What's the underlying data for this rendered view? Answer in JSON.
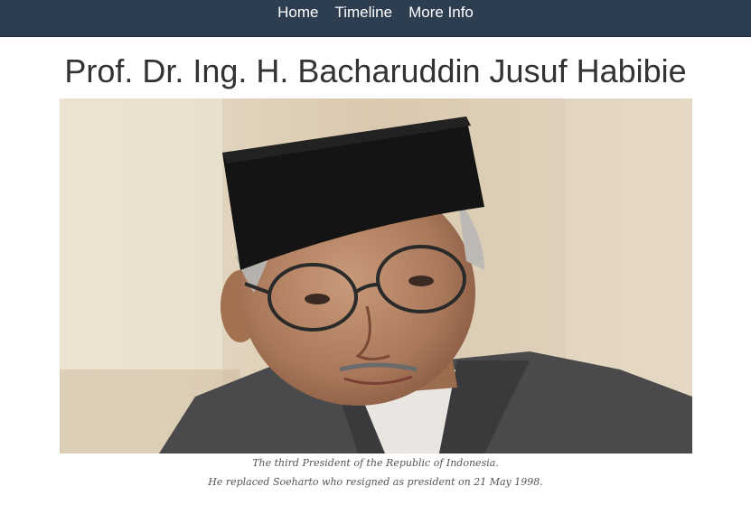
{
  "nav": {
    "items": [
      {
        "label": "Home"
      },
      {
        "label": "Timeline"
      },
      {
        "label": "More Info"
      }
    ]
  },
  "page": {
    "title": "Prof. Dr. Ing. H. Bacharuddin Jusuf Habibie"
  },
  "caption": {
    "line1": "The third President of the Republic of Indonesia.",
    "line2": "He replaced Soeharto who resigned as president on 21 May 1998."
  }
}
